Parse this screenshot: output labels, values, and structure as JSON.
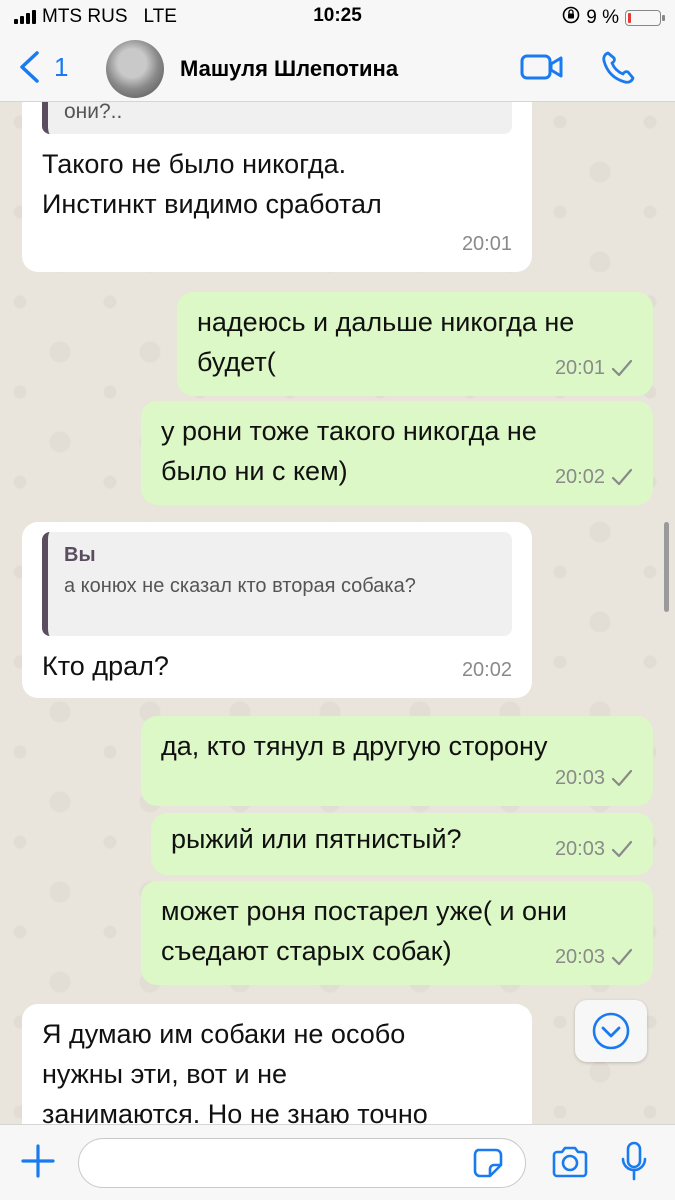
{
  "status_bar": {
    "carrier": "MTS RUS",
    "network": "LTE",
    "time": "10:25",
    "battery_text": "9 %",
    "battery_level": 0.09,
    "battery_color": "#e53935"
  },
  "header": {
    "back_count": "1",
    "contact_name": "Машуля Шлепотина",
    "icons": [
      "chevron-left-icon",
      "video-call-icon",
      "phone-icon"
    ],
    "accent_color": "#1a7bf0"
  },
  "messages": [
    {
      "direction": "in",
      "partial_quote_text": "они?..",
      "text_lines": [
        "Такого не было никогда.",
        "Инстинкт видимо сработал"
      ],
      "time": "20:01"
    },
    {
      "direction": "out",
      "text_lines": [
        "надеюсь и дальше никогда не",
        "будет("
      ],
      "time": "20:01",
      "status": "sent"
    },
    {
      "direction": "out",
      "text_lines": [
        "у рони тоже такого никогда не",
        "было ни с кем)"
      ],
      "time": "20:02",
      "status": "sent"
    },
    {
      "direction": "in",
      "quote": {
        "author": "Вы",
        "text": "а конюх не сказал кто вторая собака?"
      },
      "text_lines": [
        "Кто драл?"
      ],
      "time": "20:02"
    },
    {
      "direction": "out",
      "text_lines": [
        "да, кто тянул в другую сторону"
      ],
      "time": "20:03",
      "status": "sent"
    },
    {
      "direction": "out",
      "text_lines": [
        "рыжий или пятнистый?"
      ],
      "time": "20:03",
      "status": "sent"
    },
    {
      "direction": "out",
      "text_lines": [
        "может роня постарел уже( и они",
        "съедают старых собак)"
      ],
      "time": "20:03",
      "status": "sent"
    },
    {
      "direction": "in",
      "text_lines": [
        "Я думаю им собаки не особо",
        "нужны эти, вот и не",
        "занимаются. Но не знаю точно"
      ],
      "time": ""
    }
  ],
  "colors": {
    "incoming_bubble": "#ffffff",
    "outgoing_bubble": "#dcf8c6",
    "chat_background": "#e9e4dc",
    "check_color": "#8a8a8a"
  },
  "input_bar": {
    "placeholder": "",
    "icons": [
      "plus-icon",
      "sticker-icon",
      "camera-icon",
      "microphone-icon"
    ]
  }
}
